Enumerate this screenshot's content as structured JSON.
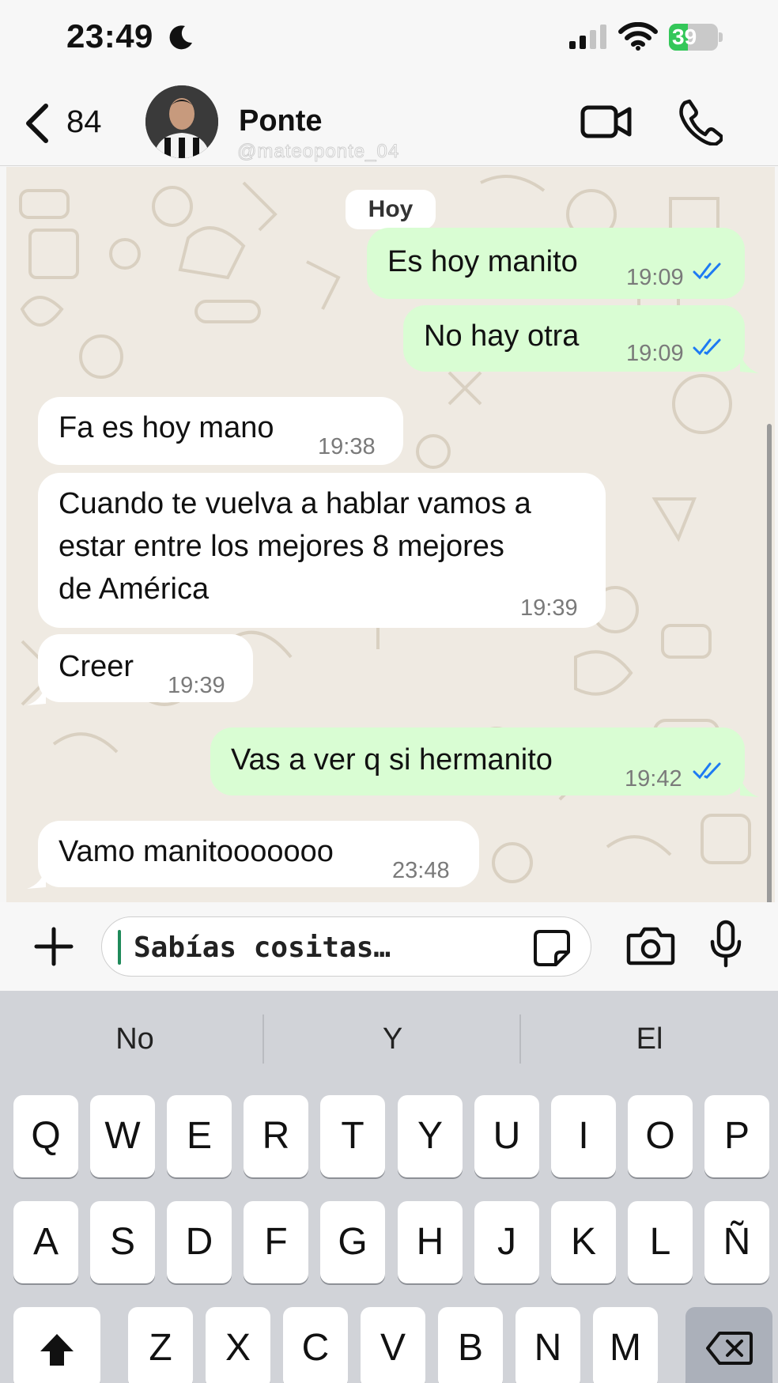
{
  "status_bar": {
    "time": "23:49",
    "battery": "39",
    "battery_level": 0.39,
    "icons": [
      "moon-icon",
      "signal-icon",
      "wifi-icon",
      "battery-icon"
    ]
  },
  "header": {
    "back_count": "84",
    "contact_name": "Ponte",
    "contact_handle": "@mateoponte_04",
    "icons": [
      "chevron-left-icon",
      "video-call-icon",
      "phone-icon"
    ]
  },
  "chat": {
    "day_label": "Hoy",
    "messages": [
      {
        "direction": "out",
        "text": "Es hoy manito",
        "time": "19:09",
        "read": true
      },
      {
        "direction": "out",
        "text": "No hay otra",
        "time": "19:09",
        "read": true
      },
      {
        "direction": "in",
        "text": "Fa es hoy mano",
        "time": "19:38"
      },
      {
        "direction": "in",
        "lines": [
          "Cuando te vuelva a hablar vamos a",
          "estar entre los mejores 8 mejores",
          "de América"
        ],
        "time": "19:39"
      },
      {
        "direction": "in",
        "text": "Creer",
        "time": "19:39"
      },
      {
        "direction": "out",
        "text": "Vas a ver q si hermanito",
        "time": "19:42",
        "read": true
      },
      {
        "direction": "in",
        "text": "Vamo manitooooooo",
        "time": "23:48"
      }
    ]
  },
  "composer": {
    "placeholder": "Sabías cositas…",
    "icons": [
      "plus-icon",
      "sticker-icon",
      "camera-icon",
      "microphone-icon"
    ]
  },
  "keyboard": {
    "suggestions": [
      "No",
      "Y",
      "El"
    ],
    "row1": [
      "Q",
      "W",
      "E",
      "R",
      "T",
      "Y",
      "U",
      "I",
      "O",
      "P"
    ],
    "row2": [
      "A",
      "S",
      "D",
      "F",
      "G",
      "H",
      "J",
      "K",
      "L",
      "Ñ"
    ],
    "row3": [
      "Z",
      "X",
      "C",
      "V",
      "B",
      "N",
      "M"
    ],
    "icons": [
      "shift-icon",
      "backspace-icon"
    ]
  },
  "colors": {
    "outgoing_bubble": "#d9fdd3",
    "incoming_bubble": "#ffffff",
    "chat_background": "#efeae2",
    "read_ticks": "#1d7af3",
    "battery_green": "#34c759"
  }
}
